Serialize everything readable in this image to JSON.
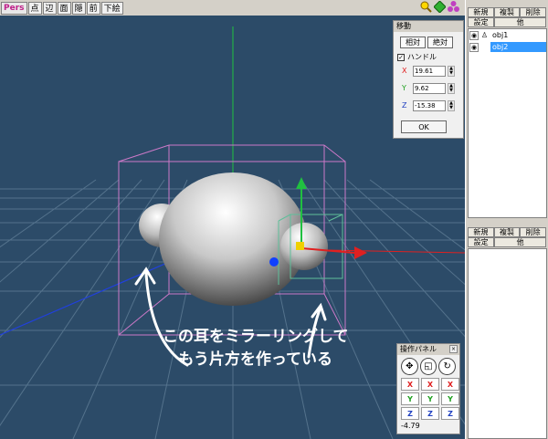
{
  "toolbar": {
    "view_mode": "Pers",
    "buttons": [
      "点",
      "辺",
      "面",
      "隠",
      "前",
      "下絵"
    ]
  },
  "move_panel": {
    "title": "移動",
    "mode_relative": "相対",
    "mode_absolute": "絶対",
    "handle_label": "ハンドル",
    "handle_checked": true,
    "x_label": "X",
    "x_value": "19.61",
    "y_label": "Y",
    "y_value": "9.62",
    "z_label": "Z",
    "z_value": "-15.38",
    "ok_label": "OK"
  },
  "object_panel": {
    "new_label": "新規",
    "copy_label": "複製",
    "delete_label": "削除",
    "settings_label": "設定",
    "other_label": "他",
    "objects": [
      {
        "name": "obj1",
        "selected": false
      },
      {
        "name": "obj2",
        "selected": true
      }
    ]
  },
  "material_panel": {
    "new_label": "新規",
    "copy_label": "複製",
    "delete_label": "削除",
    "settings_label": "設定",
    "other_label": "他"
  },
  "operation_panel": {
    "title": "操作パネル",
    "axis_rows": [
      [
        "X",
        "X",
        "X"
      ],
      [
        "Y",
        "Y",
        "Y"
      ],
      [
        "Z",
        "Z",
        "Z"
      ]
    ],
    "value": "-4.79"
  },
  "annotation": {
    "line1": "この耳をミラーリングして",
    "line2": "もう片方を作っている"
  },
  "colors": {
    "viewport_bg": "#2c4b68",
    "grid": "#5e7c95",
    "bbox_main": "#cc79c8",
    "bbox_sub": "#5fbf9a",
    "axis_x": "#e02020",
    "axis_y": "#20c040",
    "axis_z": "#2040e0"
  }
}
